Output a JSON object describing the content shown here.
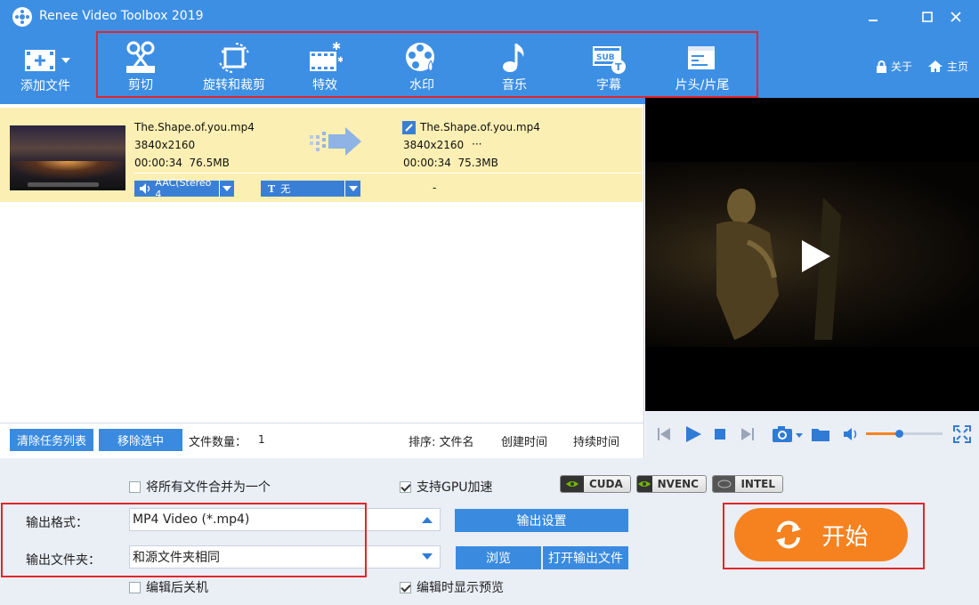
{
  "window": {
    "title": "Renee Video Toolbox 2019"
  },
  "toolbar": {
    "add_file": "添加文件",
    "tools": [
      "剪切",
      "旋转和裁剪",
      "特效",
      "水印",
      "音乐",
      "字幕",
      "片头/片尾"
    ],
    "about": "关于",
    "home": "主页"
  },
  "file": {
    "source": {
      "name": "The.Shape.of.you.mp4",
      "resolution": "3840x2160",
      "duration_size": "00:00:34  76.5MB"
    },
    "output": {
      "name": "The.Shape.of.you.mp4",
      "resolution": "3840x2160",
      "more": "···",
      "duration_size": "00:00:34  75.3MB"
    },
    "audio_track": "AAC(Stereo 4",
    "subtitle": "无",
    "dash": "-"
  },
  "list_footer": {
    "clear_btn": "清除任务列表",
    "remove_btn": "移除选中",
    "count_label": "文件数量：",
    "count": "1",
    "sort_label": "排序: 文件名",
    "sort_created": "创建时间",
    "sort_duration": "持续时间"
  },
  "player": {
    "volume_fraction": 0.43
  },
  "options": {
    "merge_label": "将所有文件合并为一个",
    "merge_checked": false,
    "gpu_label": "支持GPU加速",
    "gpu_checked": true,
    "badges": [
      "CUDA",
      "NVENC",
      "INTEL"
    ],
    "format_label": "输出格式：",
    "format_value": "MP4 Video (*.mp4)",
    "settings_btn": "输出设置",
    "folder_label": "输出文件夹：",
    "folder_value": "和源文件夹相同",
    "browse_btn": "浏览",
    "open_folder_btn": "打开输出文件",
    "shutdown_label": "编辑后关机",
    "shutdown_checked": false,
    "preview_label": "编辑时显示预览",
    "preview_checked": true,
    "start_btn": "开始"
  },
  "colors": {
    "primary": "#3d8fe4",
    "start": "#f6821f",
    "highlight": "#e3262a",
    "row": "#fcefb3"
  }
}
